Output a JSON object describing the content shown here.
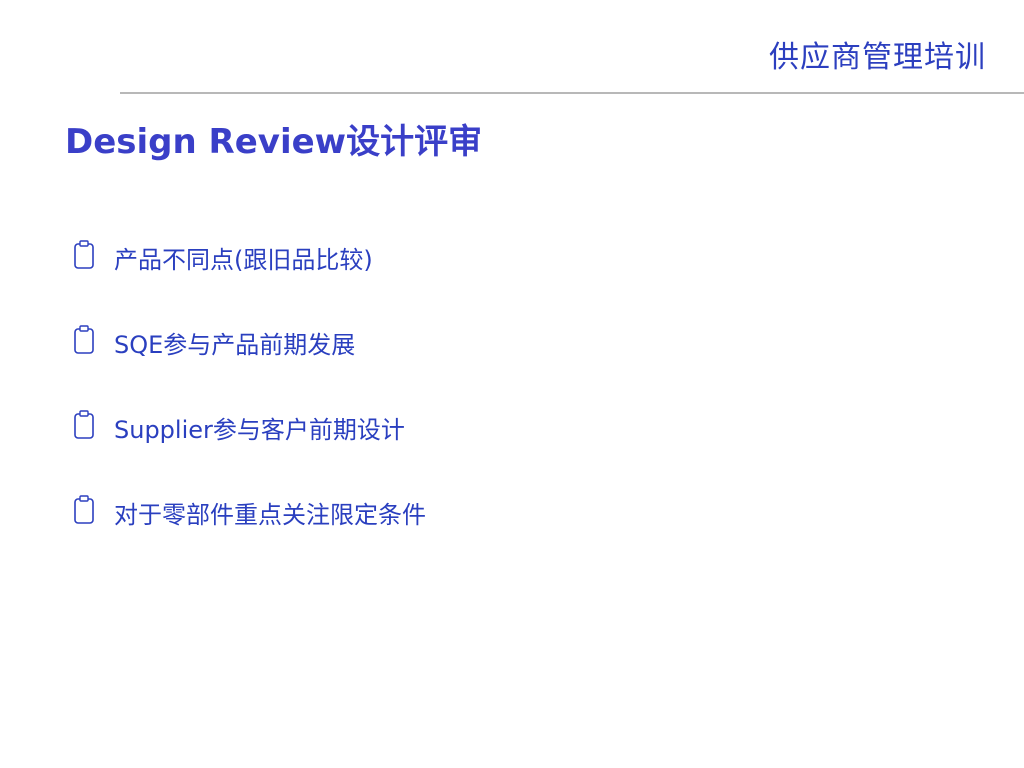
{
  "header": {
    "title": "供应商管理培训"
  },
  "slide": {
    "title": "Design Review设计评审",
    "bullets": [
      {
        "text": "产品不同点(跟旧品比较)",
        "icon": "clipboard-icon"
      },
      {
        "text": "SQE参与产品前期发展",
        "icon": "clipboard-icon"
      },
      {
        "text": "Supplier参与客户前期设计",
        "icon": "clipboard-icon"
      },
      {
        "text": "对于零部件重点关注限定条件",
        "icon": "clipboard-icon"
      }
    ]
  },
  "colors": {
    "accent": "#2c3fbf",
    "title": "#3a3fc8",
    "rule": "#b8b8b8",
    "background": "#ffffff"
  }
}
